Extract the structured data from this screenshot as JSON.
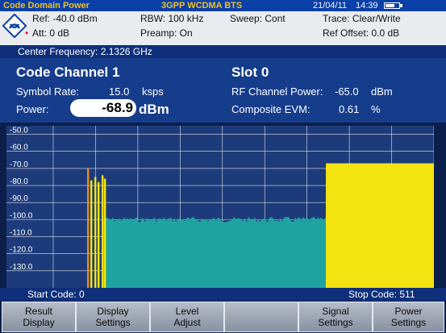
{
  "title_bar": {
    "mode": "Code Domain Power",
    "standard": "3GPP WCDMA BTS",
    "date": "21/04/11",
    "time": "14:39"
  },
  "params": {
    "ref": "Ref:  -40.0 dBm",
    "att": "Att:  0 dB",
    "rbw": "RBW:  100 kHz",
    "preamp": "Preamp:  On",
    "sweep": "Sweep:  Cont",
    "trace": "Trace:  Clear/Write",
    "ref_offset": "Ref Offset:  0.0 dB"
  },
  "center_frequency": "Center Frequency: 2.1326 GHz",
  "info": {
    "code_channel": "Code Channel  1",
    "slot": "Slot  0",
    "symbol_rate_label": "Symbol Rate:",
    "symbol_rate_value": "15.0",
    "symbol_rate_unit": "ksps",
    "power_label": "Power:",
    "power_value": "-68.9",
    "power_unit": "dBm",
    "rf_power_label": "RF Channel Power:",
    "rf_power_value": "-65.0",
    "rf_power_unit": "dBm",
    "evm_label": "Composite EVM:",
    "evm_value": "0.61",
    "evm_unit": "%"
  },
  "plot": {
    "y_ticks": [
      "-50.0",
      "-60.0",
      "-70.0",
      "-80.0",
      "-90.0",
      "-100.0",
      "-110.0",
      "-120.0",
      "-130.0"
    ],
    "y_top": -45,
    "y_bottom": -140,
    "noise_level": -100.0,
    "block_level": -67.0,
    "colors": {
      "noise": "#1ea3a1",
      "block": "#f3e310",
      "selected": "#f08a1a",
      "grid": "#dfe3ea"
    }
  },
  "codes": {
    "start": "Start Code: 0",
    "stop": "Stop Code: 511"
  },
  "softkeys": [
    {
      "line1": "Result",
      "line2": "Display"
    },
    {
      "line1": "Display",
      "line2": "Settings"
    },
    {
      "line1": "Level",
      "line2": "Adjust"
    },
    {
      "line1": "",
      "line2": ""
    },
    {
      "line1": "Signal",
      "line2": "Settings"
    },
    {
      "line1": "Power",
      "line2": "Settings"
    }
  ]
}
